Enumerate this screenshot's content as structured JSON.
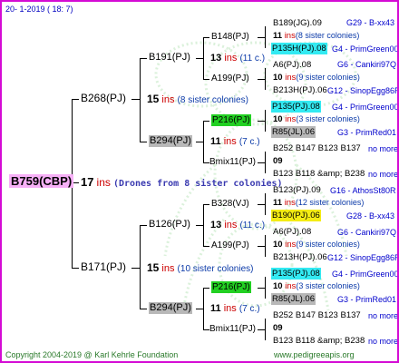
{
  "header": {
    "date": "20-   1-2019  ( 18:  7)"
  },
  "footer": {
    "copyright": "Copyright 2004-2019 @ Karl Kehrle Foundation",
    "url": "www.pedigreeapis.org"
  },
  "root": {
    "label": "B759(CBP)",
    "ins_num": "17",
    "ins": "ins",
    "desc": "(Drones from 8 sister colonies)"
  },
  "gen1": {
    "top": {
      "label": "B268(PJ)",
      "ins_num": "15",
      "ins": "ins",
      "desc": "(8 sister colonies)"
    },
    "bottom": {
      "label": "B171(PJ)",
      "ins_num": "15",
      "ins": "ins",
      "desc": "(10 sister colonies)"
    }
  },
  "gen2": {
    "a": {
      "label": "B191(PJ)",
      "ins_num": "13",
      "ins": "ins",
      "desc": "(11 c.)"
    },
    "b": {
      "label": "B294(PJ)",
      "ins_num": "11",
      "ins": "ins",
      "desc": "(7 c.)"
    },
    "c": {
      "label": "B126(PJ)",
      "ins_num": "13",
      "ins": "ins",
      "desc": "(11 c.)"
    },
    "d": {
      "label": "B294(PJ)",
      "ins_num": "11",
      "ins": "ins",
      "desc": "(7 c.)"
    }
  },
  "gen3": {
    "a1": {
      "label": "B148(PJ)"
    },
    "a2": {
      "label": "A199(PJ)"
    },
    "b1": {
      "label": "P216(PJ)"
    },
    "b2": {
      "label": "Bmix11(PJ)"
    },
    "c1": {
      "label": "B328(VJ)"
    },
    "c2": {
      "label": "A199(PJ)"
    },
    "d1": {
      "label": "P216(PJ)"
    },
    "d2": {
      "label": "Bmix11(PJ)"
    }
  },
  "gen4": [
    {
      "parent": "B189(JG).09",
      "code": "G29 - B-xx43",
      "ins_num": "11",
      "ins": "ins",
      "desc": "(8 sister colonies)",
      "sub": "P135H(PJ).08",
      "subcode": "G4 - PrimGreen00"
    },
    {
      "parent": "A6(PJ).08",
      "code": "G6 - Cankiri97Q",
      "ins_num": "10",
      "ins": "ins",
      "desc": "(9 sister colonies)",
      "sub": "B213H(PJ).06",
      "subcode": "G12 - SinopEgg86R"
    },
    {
      "parent": "P135(PJ).08",
      "code": "G4 - PrimGreen00",
      "ins_num": "10",
      "ins": "ins",
      "desc": "(3 sister colonies)",
      "sub": "R85(JL).06",
      "subcode": "G3 - PrimRed01"
    },
    {
      "parent": "B252 B147 B123 B137",
      "code": "no more",
      "ins_num": "09",
      "ins": "",
      "desc": "",
      "sub": "B123 B118 &amp; B238",
      "subcode": "no more"
    },
    {
      "parent": "B123(PJ).09",
      "code": "G16 - AthosSt80R",
      "ins_num": "11",
      "ins": "ins",
      "desc": "(12 sister colonies)",
      "sub": "B190(PJ).06",
      "subcode": "G28 - B-xx43"
    },
    {
      "parent": "A6(PJ).08",
      "code": "G6 - Cankiri97Q",
      "ins_num": "10",
      "ins": "ins",
      "desc": "(9 sister colonies)",
      "sub": "B213H(PJ).06",
      "subcode": "G12 - SinopEgg86R"
    },
    {
      "parent": "P135(PJ).08",
      "code": "G4 - PrimGreen00",
      "ins_num": "10",
      "ins": "ins",
      "desc": "(3 sister colonies)",
      "sub": "R85(JL).06",
      "subcode": "G3 - PrimRed01"
    },
    {
      "parent": "B252 B147 B123 B137",
      "code": "no more",
      "ins_num": "09",
      "ins": "",
      "desc": "",
      "sub": "B123 B118 &amp; B238",
      "subcode": "no more"
    }
  ],
  "colors": {
    "border": "#d40bd4",
    "root_bg": "#f7b0f7",
    "cyan": "#33eaf2",
    "green": "#22d022",
    "gray": "#b8b8b8",
    "yellow": "#f4ec14",
    "ins_red": "#cc0000",
    "code_blue": "#0000cc"
  }
}
